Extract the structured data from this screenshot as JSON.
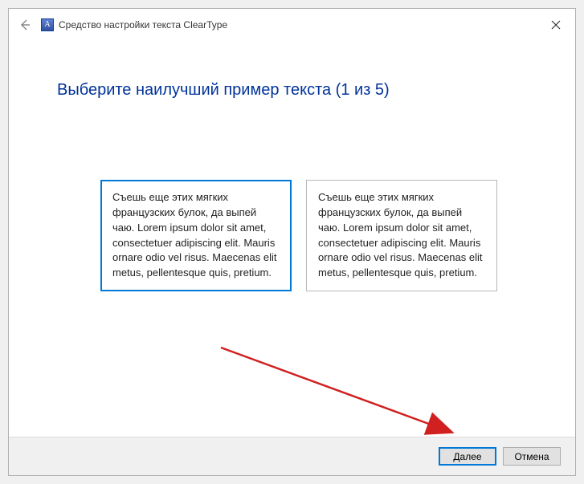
{
  "window": {
    "title": "Средство настройки текста ClearType"
  },
  "heading": "Выберите наилучший пример текста (1 из 5)",
  "samples": [
    {
      "text": "Съешь еще этих мягких французских булок, да выпей чаю. Lorem ipsum dolor sit amet, consectetuer adipiscing elit. Mauris ornare odio vel risus. Maecenas elit metus, pellentesque quis, pretium.",
      "selected": true
    },
    {
      "text": "Съешь еще этих мягких французских булок, да выпей чаю. Lorem ipsum dolor sit amet, consectetuer adipiscing elit. Mauris ornare odio vel risus. Maecenas elit metus, pellentesque quis, pretium.",
      "selected": false
    }
  ],
  "buttons": {
    "next": "Далее",
    "cancel": "Отмена"
  },
  "icons": {
    "app_letter": "A"
  }
}
